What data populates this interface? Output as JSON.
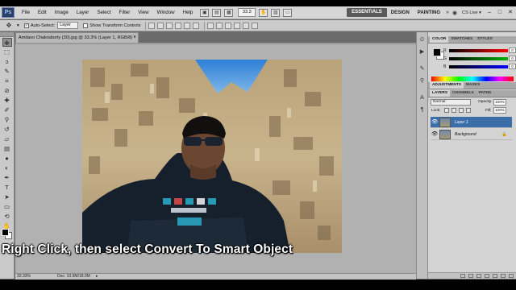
{
  "app": {
    "logo_text": "Ps",
    "menus": [
      "File",
      "Edit",
      "Image",
      "Layer",
      "Select",
      "Filter",
      "View",
      "Window",
      "Help"
    ],
    "zoom_field": "33.3",
    "workspaces": {
      "essentials": "ESSENTIALS",
      "design": "DESIGN",
      "painting": "PAINTING",
      "more": "»"
    },
    "cslive": "CS Live ▾",
    "window_controls": {
      "minimize": "–",
      "restore": "□",
      "close": "✕"
    }
  },
  "options": {
    "tool_icon": "move-tool-icon",
    "auto_select_label": "Auto-Select:",
    "auto_select_value": "Layer",
    "show_transform_label": "Show Transform Controls"
  },
  "document": {
    "tab_title": "Amitavo Chakraborty (30).jpg @ 33.3% (Layer 1, RGB/8) *",
    "close": "×",
    "status_zoom": "33.33%",
    "status_doc": "Doc: 10.9M/18.0M",
    "status_arrow": "▸"
  },
  "caption": "Right Click, then select Convert To Smart Object",
  "color_panel": {
    "tabs": [
      "COLOR",
      "SWATCHES",
      "STYLES"
    ],
    "channels": [
      {
        "letter": "R",
        "value": "0",
        "color": "#ff0000"
      },
      {
        "letter": "G",
        "value": "0",
        "color": "#00b000"
      },
      {
        "letter": "B",
        "value": "0",
        "color": "#0000ff"
      }
    ]
  },
  "adjustments_panel": {
    "tabs": [
      "ADJUSTMENTS",
      "MASKS"
    ]
  },
  "layers_panel": {
    "tabs": [
      "LAYERS",
      "CHANNELS",
      "PATHS"
    ],
    "blend_mode": "Normal",
    "opacity_label": "Opacity:",
    "opacity_value": "100%",
    "lock_label": "Lock:",
    "fill_label": "Fill:",
    "fill_value": "100%",
    "layers": [
      {
        "name": "Layer 1",
        "selected": true
      },
      {
        "name": "Background",
        "selected": false,
        "locked": true
      }
    ]
  },
  "colors": {
    "selection_blue": "#3a6ea8",
    "menubar_bg": "#d6d6d6",
    "canvas_bg": "#b1b1b1"
  }
}
